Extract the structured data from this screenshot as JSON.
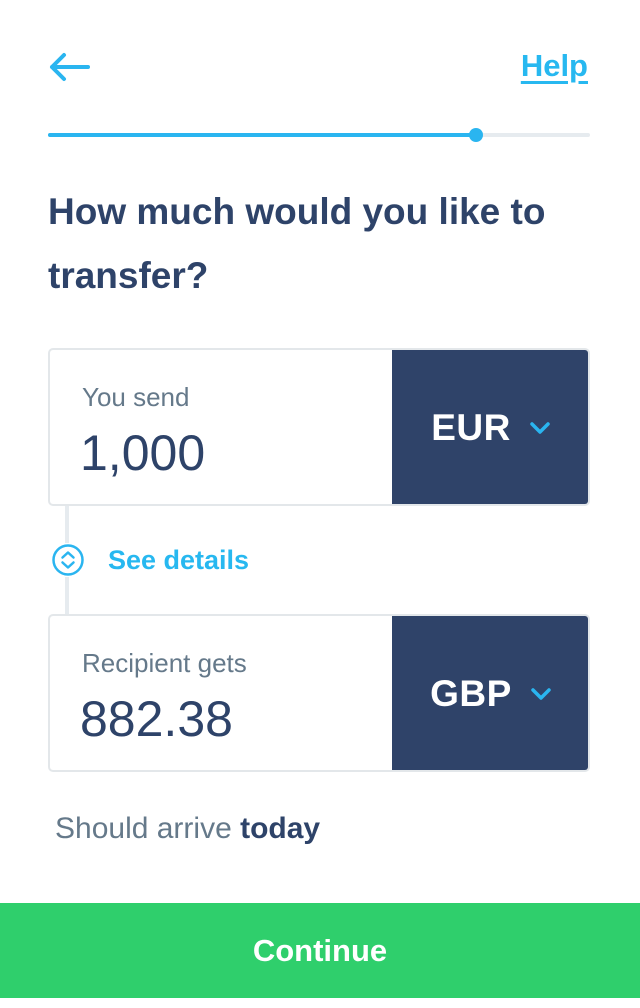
{
  "header": {
    "back_icon": "arrow-left-icon",
    "help_label": "Help"
  },
  "progress": {
    "fraction": 0.79
  },
  "title": "How much would you like to transfer?",
  "send": {
    "label": "You send",
    "amount": "1,000",
    "currency": "EUR",
    "chevron_icon": "chevron-down-icon"
  },
  "details": {
    "icon": "expand-collapse-icon",
    "label": "See details"
  },
  "receive": {
    "label": "Recipient gets",
    "amount": "882.38",
    "currency": "GBP",
    "chevron_icon": "chevron-down-icon"
  },
  "arrival": {
    "prefix": "Should arrive",
    "when": "today"
  },
  "continue_label": "Continue",
  "colors": {
    "accent": "#2ab5f0",
    "navy": "#2f4369",
    "green": "#2fcf6c",
    "muted_text": "#65798a"
  }
}
